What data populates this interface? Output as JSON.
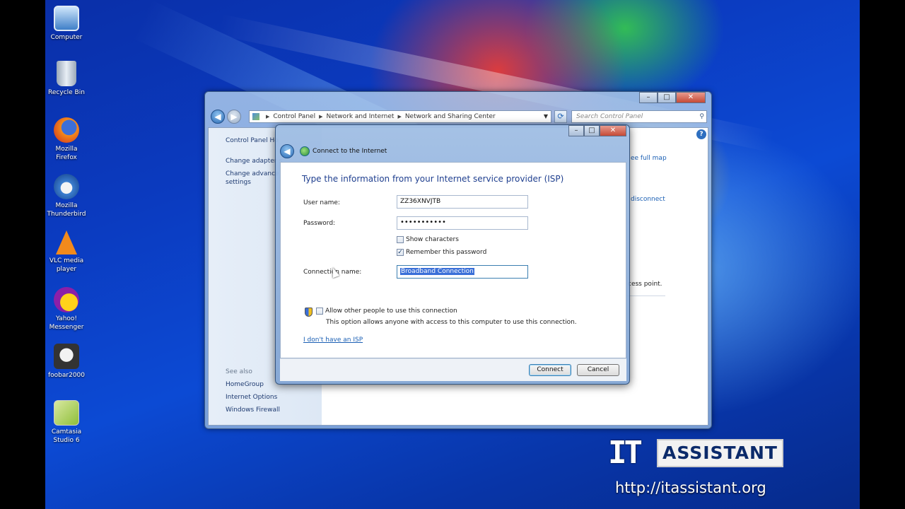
{
  "desktop": {
    "icons": [
      {
        "label_lines": [
          "Computer"
        ]
      },
      {
        "label_lines": [
          "Recycle Bin"
        ]
      },
      {
        "label_lines": [
          "Mozilla",
          "Firefox"
        ]
      },
      {
        "label_lines": [
          "Mozilla",
          "Thunderbird"
        ]
      },
      {
        "label_lines": [
          "VLC media",
          "player"
        ]
      },
      {
        "label_lines": [
          "Yahoo!",
          "Messenger"
        ]
      },
      {
        "label_lines": [
          "foobar2000"
        ]
      },
      {
        "label_lines": [
          "Camtasia",
          "Studio 6"
        ]
      }
    ]
  },
  "explorer": {
    "breadcrumb": [
      "Control Panel",
      "Network and Internet",
      "Network and Sharing Center"
    ],
    "search_placeholder": "Search Control Panel",
    "left_pane": {
      "home": "Control Panel Ho",
      "change_adapter": "Change adapter s",
      "change_advanced_line1": "Change advance",
      "change_advanced_line2": "settings",
      "see_also": "See also",
      "homegroup": "HomeGroup",
      "internet_options": "Internet Options",
      "windows_firewall": "Windows Firewall"
    },
    "bg_texts": {
      "see_full_map": "ee full map",
      "disconnect": "disconnect",
      "access_point": "cess point."
    }
  },
  "dialog": {
    "title": "Connect to the Internet",
    "heading": "Type the information from your Internet service provider (ISP)",
    "username_label": "User name:",
    "username_value": "ZZ36XNVJTB",
    "password_label": "Password:",
    "password_value": "•••••••••••",
    "show_characters": "Show characters",
    "show_characters_checked": false,
    "remember_password": "Remember this password",
    "remember_password_checked": true,
    "connection_name_label": "Connection name:",
    "connection_name_value": "Broadband Connection",
    "allow_others": "Allow other people to use this connection",
    "allow_others_checked": false,
    "allow_others_desc": "This option allows anyone with access to this computer to use this connection.",
    "no_isp_link": "I don't have an ISP",
    "connect_button": "Connect",
    "cancel_button": "Cancel"
  },
  "watermark": {
    "tools_text": "IT",
    "brand": "ASSISTANT",
    "url": "http://itassistant.org"
  },
  "colors": {
    "accent": "#1f3f8f",
    "link": "#1a5fb4",
    "selection": "#3a6fd8"
  }
}
